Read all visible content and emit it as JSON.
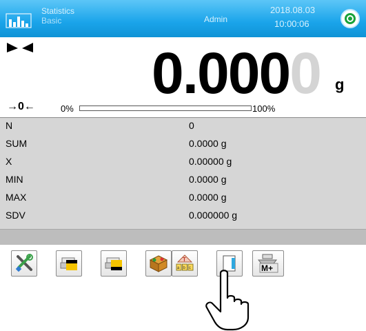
{
  "header": {
    "app_name": "Statistics",
    "app_sub": "Basic",
    "user": "Admin",
    "date": "2018.08.03",
    "time": "10:00:06"
  },
  "weighing": {
    "value_main": "0.000",
    "value_last": "0",
    "unit": "g",
    "zero_indicator": "→0←",
    "bar_min": "0%",
    "bar_max": "100%",
    "bar_fill_percent": 0
  },
  "stats": [
    {
      "label": "N",
      "value": "0"
    },
    {
      "label": "SUM",
      "value": "0.0000 g"
    },
    {
      "label": "X",
      "value": "0.00000 g"
    },
    {
      "label": "MIN",
      "value": "0.0000 g"
    },
    {
      "label": "MAX",
      "value": "0.0000 g"
    },
    {
      "label": "SDV",
      "value": "0.000000 g"
    }
  ],
  "toolbar": [
    {
      "icon": "tools-icon"
    },
    {
      "icon": "printer-header-icon"
    },
    {
      "icon": "printer-footer-icon"
    },
    {
      "icon": "products-box-icon"
    },
    {
      "icon": "tare-abc-icon"
    },
    {
      "icon": "clear-statistics-icon"
    },
    {
      "icon": "memory-add-icon",
      "label": "M+"
    }
  ],
  "colors": {
    "header_gradient": [
      "#5cc6f7",
      "#0f93d6"
    ],
    "status_green": "#17a23a",
    "stats_bg": "#d6d6d6"
  }
}
